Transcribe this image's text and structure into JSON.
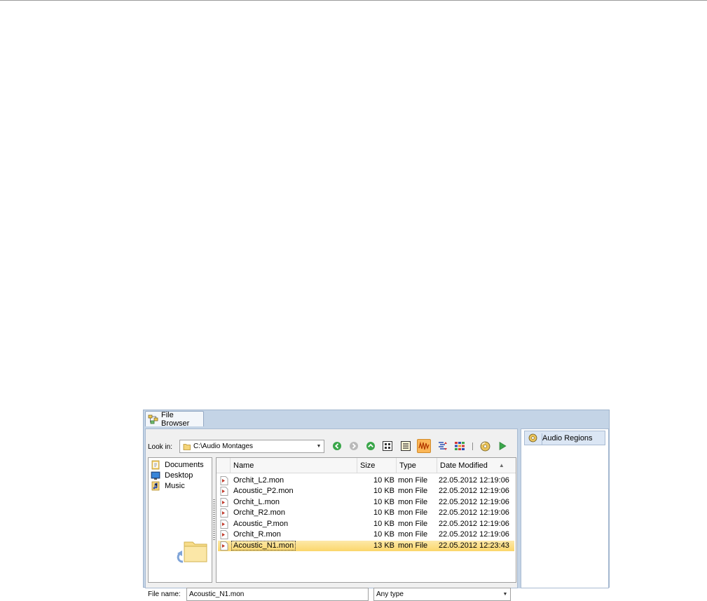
{
  "file_browser": {
    "tab_label": "File Browser",
    "look_in_label": "Look in:",
    "current_path": "C:\\Audio Montages",
    "toolbar": {
      "icons": [
        "back-icon",
        "forward-icon",
        "up-folder-icon",
        "list-view-icon",
        "details-view-icon",
        "waveform-icon",
        "sort-icon",
        "grid-icon",
        "disc-icon",
        "play-icon"
      ],
      "active": "waveform-icon"
    },
    "places": [
      {
        "label": "Documents",
        "icon": "documents-icon"
      },
      {
        "label": "Desktop",
        "icon": "desktop-icon"
      },
      {
        "label": "Music",
        "icon": "music-folder-icon"
      }
    ],
    "columns": {
      "name": "Name",
      "size": "Size",
      "type": "Type",
      "date": "Date Modified"
    },
    "files": [
      {
        "name": "Orchit_L2.mon",
        "size": "10 KB",
        "type": "mon File",
        "date": "22.05.2012 12:19:06"
      },
      {
        "name": "Acoustic_P2.mon",
        "size": "10 KB",
        "type": "mon File",
        "date": "22.05.2012 12:19:06"
      },
      {
        "name": "Orchit_L.mon",
        "size": "10 KB",
        "type": "mon File",
        "date": "22.05.2012 12:19:06"
      },
      {
        "name": "Orchit_R2.mon",
        "size": "10 KB",
        "type": "mon File",
        "date": "22.05.2012 12:19:06"
      },
      {
        "name": "Acoustic_P.mon",
        "size": "10 KB",
        "type": "mon File",
        "date": "22.05.2012 12:19:06"
      },
      {
        "name": "Orchit_R.mon",
        "size": "10 KB",
        "type": "mon File",
        "date": "22.05.2012 12:19:06"
      },
      {
        "name": "Acoustic_N1.mon",
        "size": "13 KB",
        "type": "mon File",
        "date": "22.05.2012 12:23:43"
      }
    ],
    "selected_file": "Acoustic_N1.mon",
    "file_name_label": "File name:",
    "file_name_value": "Acoustic_N1.mon",
    "file_type_value": "Any type"
  },
  "regions_panel": {
    "tab_label": "Audio Regions"
  },
  "colors": {
    "selection": "#fbd66b",
    "active_tool": "#fbb657",
    "frame": "#c4d4e6",
    "file_text": "#000000"
  }
}
